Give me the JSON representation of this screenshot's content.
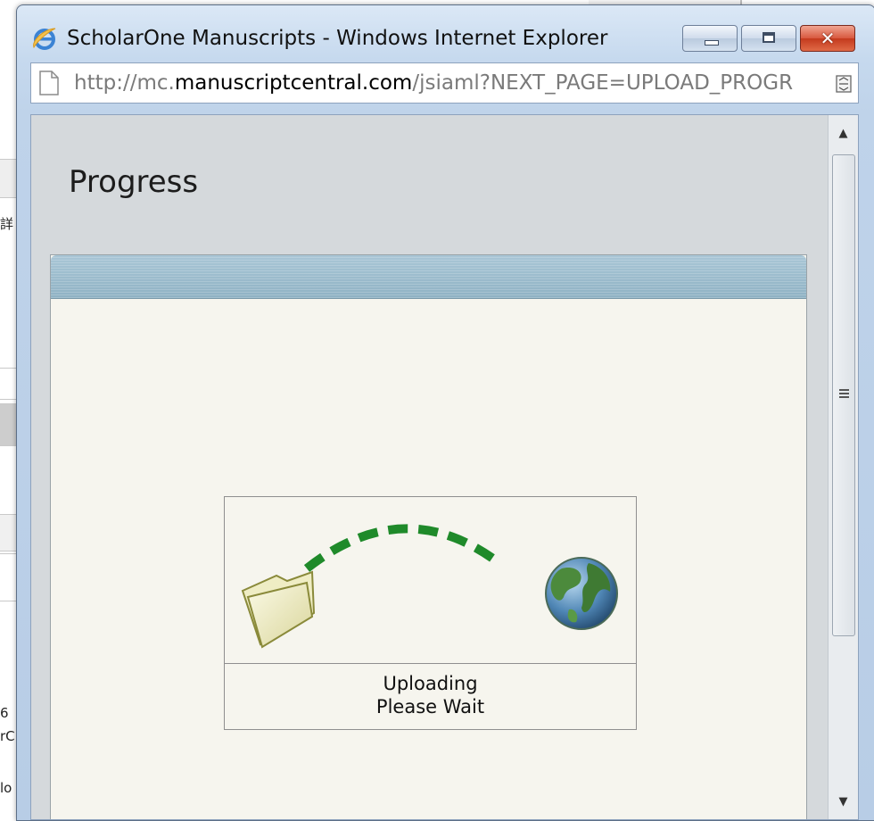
{
  "window": {
    "title": "ScholarOne Manuscripts - Windows Internet Explorer",
    "close_symbol": "✕"
  },
  "address_bar": {
    "url_prefix": "http://mc.",
    "url_domain": "manuscriptcentral.com",
    "url_path": "/jsiaml?NEXT_PAGE=UPLOAD_PROGR"
  },
  "page": {
    "heading": "Progress",
    "upload": {
      "line1": "Uploading",
      "line2": "Please Wait"
    }
  },
  "scrollbar": {
    "up_arrow": "▲",
    "down_arrow": "▼"
  },
  "background_fragments": [
    "詳",
    "6",
    "rC",
    "lo"
  ],
  "icons": [
    "ie-icon",
    "page-icon",
    "compat-view-icon",
    "folder-icon",
    "globe-icon",
    "upload-arc-icon"
  ],
  "colors": {
    "titlebar": "#c6d9ee",
    "content_background": "#d5d9dc",
    "panel_header": "#9bbccd",
    "panel_body": "#f6f5ee",
    "arc_green": "#1f8a2a",
    "close_button": "#c43a1d"
  }
}
